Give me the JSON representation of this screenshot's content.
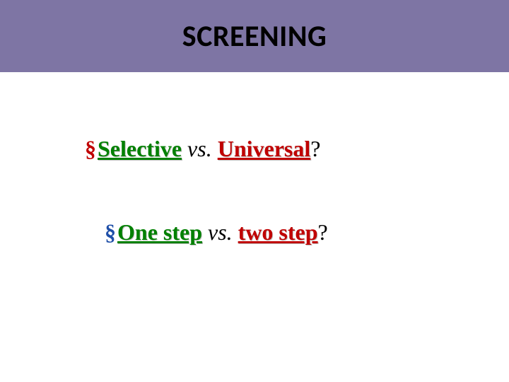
{
  "title": "SCREENING",
  "line1": {
    "term1": "Selective",
    "vs": " vs. ",
    "term2": "Universal",
    "tail": "?"
  },
  "line2": {
    "term1": "One step",
    "vs": " vs. ",
    "term2": "two step",
    "tail": "?"
  },
  "bullet": "§"
}
